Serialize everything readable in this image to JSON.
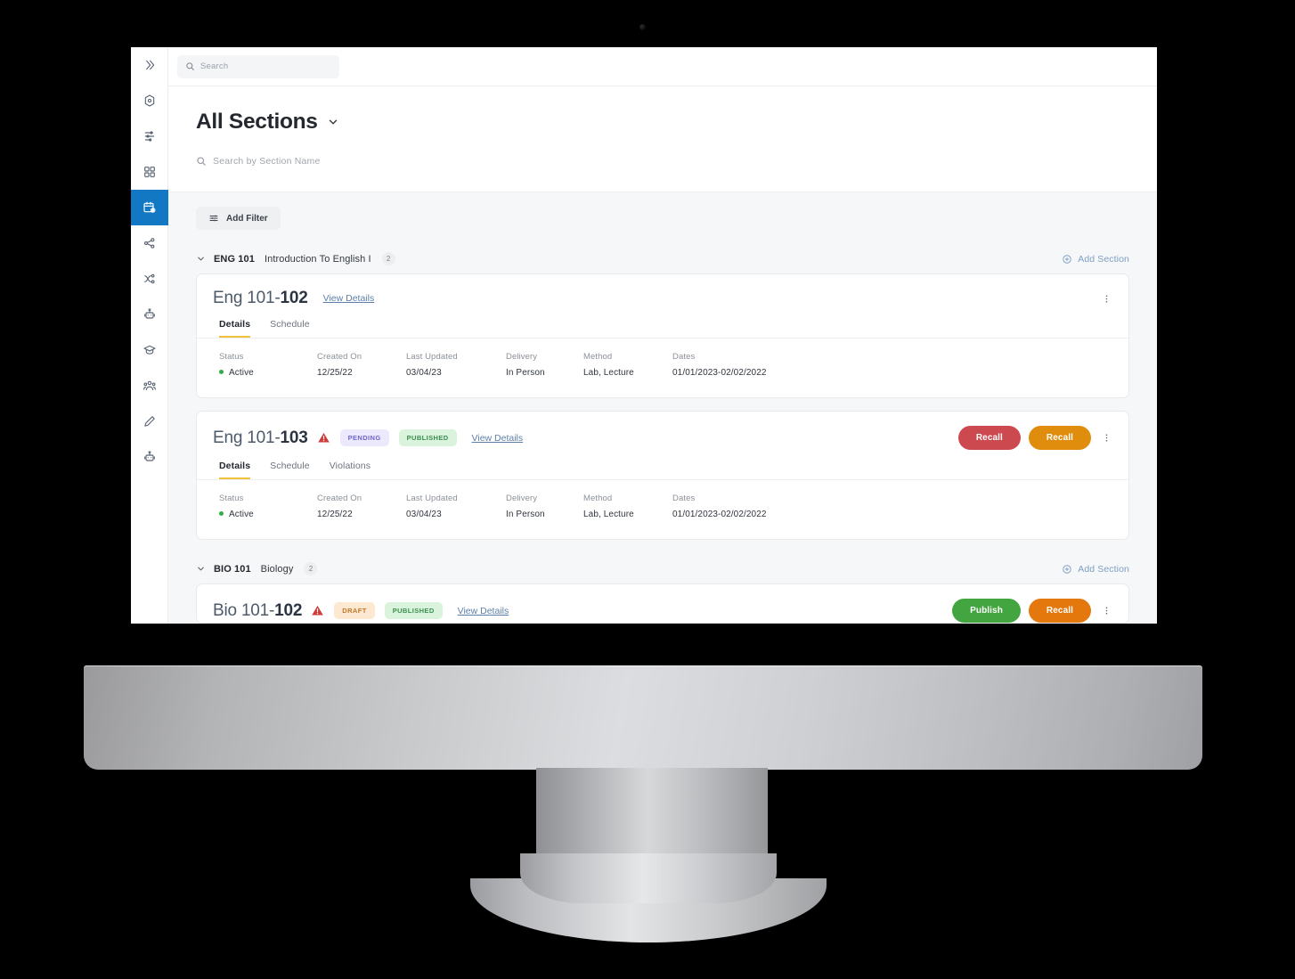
{
  "app": {
    "rail": {
      "collapse_label": "expand-rail",
      "items": [
        {
          "icon": "chevrons-right-icon",
          "name": "expand-rail-button",
          "active": false
        },
        {
          "icon": "cube-settings-icon",
          "name": "rail-item-settings",
          "active": false
        },
        {
          "icon": "sliders-icon",
          "name": "rail-item-filters",
          "active": false
        },
        {
          "icon": "grid-icon",
          "name": "rail-item-dashboard",
          "active": false
        },
        {
          "icon": "calendar-clock-icon",
          "name": "rail-item-sections",
          "active": true
        },
        {
          "icon": "sitemap-icon",
          "name": "rail-item-hierarchy",
          "active": false
        },
        {
          "icon": "branch-icon",
          "name": "rail-item-workflow",
          "active": false
        },
        {
          "icon": "robot-icon",
          "name": "rail-item-automation",
          "active": false
        },
        {
          "icon": "cap-icon",
          "name": "rail-item-courses",
          "active": false
        },
        {
          "icon": "people-icon",
          "name": "rail-item-people",
          "active": false
        },
        {
          "icon": "pencil-icon",
          "name": "rail-item-edit",
          "active": false
        },
        {
          "icon": "robot-alt-icon",
          "name": "rail-item-bots",
          "active": false
        }
      ]
    },
    "topbar": {
      "search_placeholder": "Search"
    },
    "header": {
      "title": "All Sections",
      "section_search_placeholder": "Search by Section Name"
    },
    "toolbar": {
      "add_filter_label": "Add Filter"
    },
    "add_section_label": "Add Section",
    "colors": {
      "rail_active": "#1278c4",
      "tab_underline": "#f0c23b",
      "link": "#5c7fa8",
      "status_dot": "#2fae46",
      "recall_red": "#cc4a4f",
      "recall_orange": "#e08c0d",
      "publish_green": "#42a53f",
      "recall_orange2": "#e5780c"
    },
    "detail_labels": [
      "Status",
      "Created On",
      "Last Updated",
      "Delivery",
      "Method",
      "Dates"
    ],
    "groups": [
      {
        "code": "ENG 101",
        "name": "Introduction To English I",
        "count": "2",
        "cards": [
          {
            "title_prefix": "Eng 101-",
            "title_suffix": "102",
            "warning": false,
            "badges": [],
            "view_details": "View Details",
            "actions": [],
            "tabs": [
              "Details",
              "Schedule"
            ],
            "active_tab": "Details",
            "details": {
              "status": "Active",
              "created_on": "12/25/22",
              "last_updated": "03/04/23",
              "delivery": "In Person",
              "method": "Lab, Lecture",
              "dates": "01/01/2023-02/02/2022"
            }
          },
          {
            "title_prefix": "Eng 101-",
            "title_suffix": "103",
            "warning": true,
            "badges": [
              {
                "label": "PENDING",
                "style": "pending"
              },
              {
                "label": "PUBLISHED",
                "style": "published"
              }
            ],
            "view_details": "View Details",
            "actions": [
              {
                "label": "Recall",
                "style": "red"
              },
              {
                "label": "Recall",
                "style": "orange"
              }
            ],
            "tabs": [
              "Details",
              "Schedule",
              "Violations"
            ],
            "active_tab": "Details",
            "details": {
              "status": "Active",
              "created_on": "12/25/22",
              "last_updated": "03/04/23",
              "delivery": "In Person",
              "method": "Lab, Lecture",
              "dates": "01/01/2023-02/02/2022"
            }
          }
        ]
      },
      {
        "code": "BIO 101",
        "name": "Biology",
        "count": "2",
        "cards": [
          {
            "title_prefix": "Bio 101-",
            "title_suffix": "102",
            "warning": true,
            "badges": [
              {
                "label": "DRAFT",
                "style": "draft"
              },
              {
                "label": "PUBLISHED",
                "style": "published"
              }
            ],
            "view_details": "View Details",
            "actions": [
              {
                "label": "Publish",
                "style": "green"
              },
              {
                "label": "Recall",
                "style": "orange2"
              }
            ],
            "tabs": [],
            "active_tab": "",
            "details": null
          }
        ]
      }
    ]
  }
}
